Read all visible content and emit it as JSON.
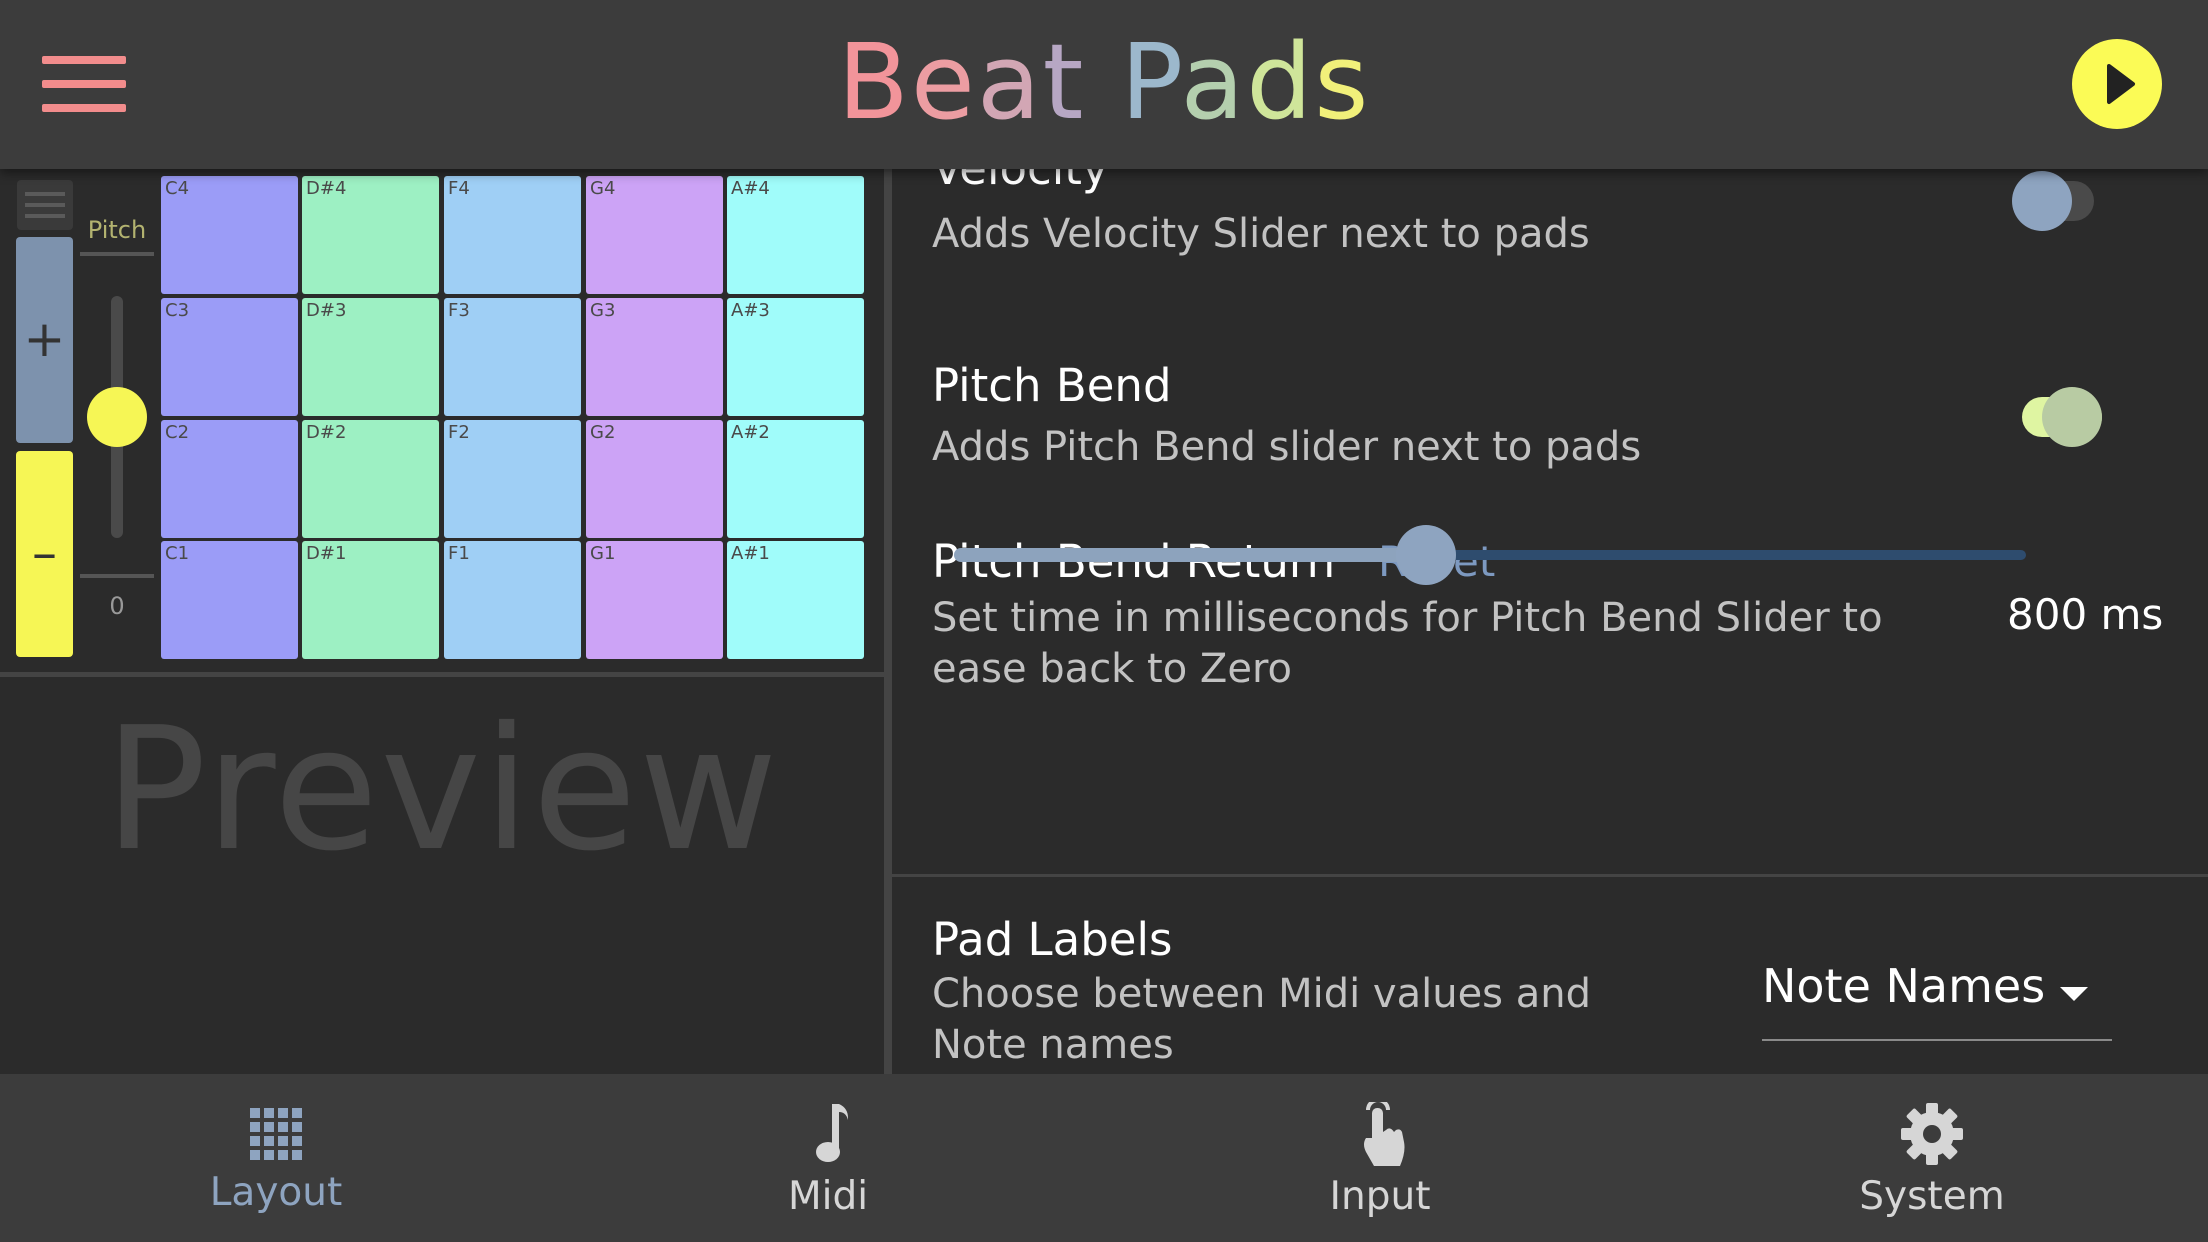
{
  "header": {
    "title_letters": [
      {
        "ch": "B",
        "color": "#f2949a"
      },
      {
        "ch": "e",
        "color": "#ec9da2"
      },
      {
        "ch": "a",
        "color": "#d2a6b4"
      },
      {
        "ch": "t",
        "color": "#b7a7c4"
      },
      {
        "ch": " ",
        "color": "#ffffff"
      },
      {
        "ch": "P",
        "color": "#9cb8cc"
      },
      {
        "ch": "a",
        "color": "#b4cfae"
      },
      {
        "ch": "d",
        "color": "#cfe59a"
      },
      {
        "ch": "s",
        "color": "#f1f07a"
      }
    ]
  },
  "preview": {
    "pitch_label": "Pitch",
    "pitch_zero": "0",
    "octave_up_symbol": "+",
    "octave_down_symbol": "–",
    "watermark": "Preview",
    "pad_rows": [
      [
        "C4",
        "D#4",
        "F4",
        "G4",
        "A#4"
      ],
      [
        "C3",
        "D#3",
        "F3",
        "G3",
        "A#3"
      ],
      [
        "C2",
        "D#2",
        "F2",
        "G2",
        "A#2"
      ],
      [
        "C1",
        "D#1",
        "F1",
        "G1",
        "A#1"
      ]
    ],
    "pad_colors": [
      "#9b9cf7",
      "#9df0c3",
      "#9fcff5",
      "#cca3f6",
      "#a0fcfa"
    ]
  },
  "settings": {
    "velocity": {
      "title": "Velocity",
      "description": "Adds Velocity Slider next to pads",
      "enabled": false
    },
    "pitch_bend": {
      "title": "Pitch Bend",
      "description": "Adds Pitch Bend slider next to pads",
      "enabled": true
    },
    "pitch_bend_return": {
      "title": "Pitch Bend Return",
      "reset_label": "Reset",
      "description_line1": "Set time in milliseconds for Pitch Bend Slider to",
      "description_line2": "ease back to Zero",
      "value_text": "800 ms",
      "slider_fraction": 0.44
    },
    "pad_labels": {
      "title": "Pad Labels",
      "description_line1": "Choose between Midi values and",
      "description_line2": "Note names",
      "selected": "Note Names"
    }
  },
  "bottom_nav": {
    "items": [
      {
        "label": "Layout",
        "icon": "grid-icon",
        "active": true
      },
      {
        "label": "Midi",
        "icon": "music-note-icon",
        "active": false
      },
      {
        "label": "Input",
        "icon": "touch-icon",
        "active": false
      },
      {
        "label": "System",
        "icon": "gear-icon",
        "active": false
      }
    ],
    "active_color": "#8ea4c0",
    "inactive_color": "#d6d6d6"
  }
}
